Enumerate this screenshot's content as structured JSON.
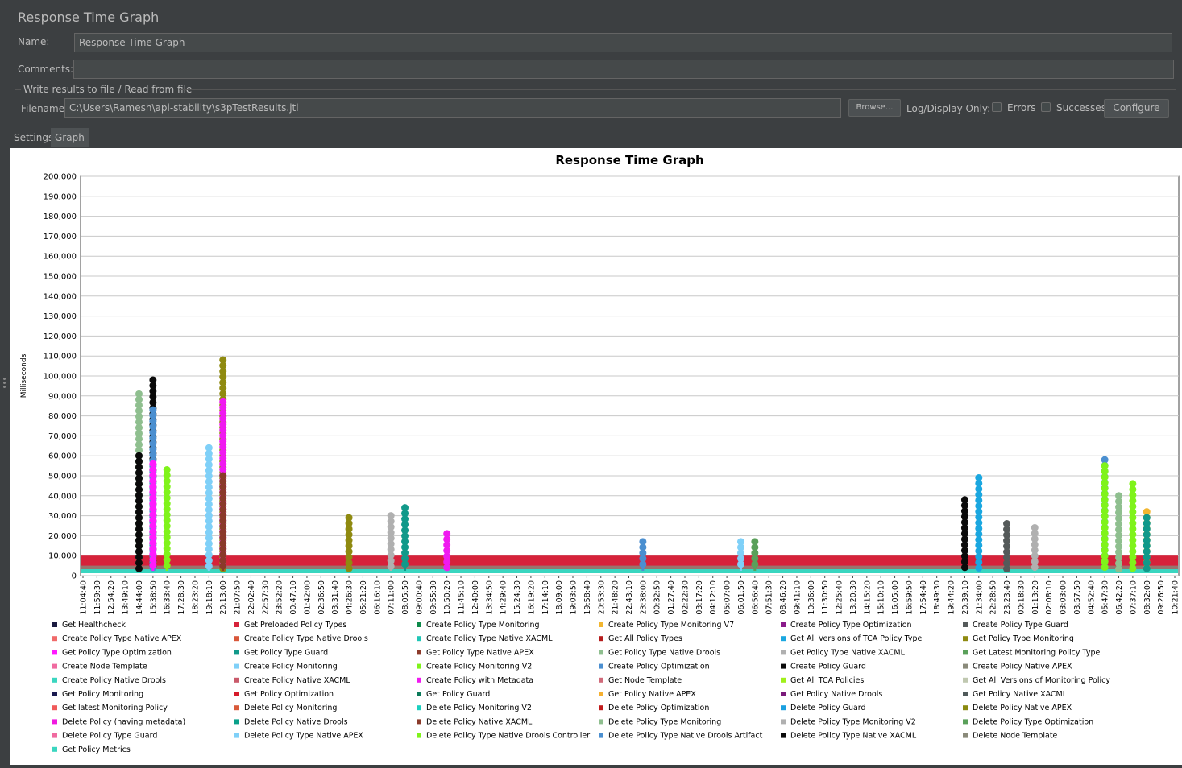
{
  "window": {
    "title": "Response Time Graph"
  },
  "form": {
    "name_label": "Name:",
    "name_value": "Response Time Graph",
    "comments_label": "Comments:",
    "comments_value": "",
    "file_group_label": "Write results to file / Read from file",
    "filename_label": "Filename",
    "filename_value": "C:\\Users\\Ramesh\\api-stability\\s3pTestResults.jtl",
    "browse_label": "Browse...",
    "log_display_label": "Log/Display Only:",
    "errors_label": "Errors",
    "successes_label": "Successes",
    "configure_label": "Configure"
  },
  "tabs": [
    {
      "label": "Settings",
      "active": false
    },
    {
      "label": "Graph",
      "active": true
    }
  ],
  "chart_data": {
    "type": "line",
    "title": "Response Time Graph",
    "ylabel": "Milliseconds",
    "xlabel": "",
    "ylim": [
      0,
      200000
    ],
    "y_ticks": [
      "0",
      "10,000",
      "20,000",
      "30,000",
      "40,000",
      "50,000",
      "60,000",
      "70,000",
      "80,000",
      "90,000",
      "100,000",
      "110,000",
      "120,000",
      "130,000",
      "140,000",
      "150,000",
      "160,000",
      "170,000",
      "180,000",
      "190,000",
      "200,000"
    ],
    "x_ticks": [
      "11:04:40",
      "11:59:30",
      "12:54:20",
      "13:49:10",
      "14:44:00",
      "15:38:50",
      "16:33:40",
      "17:28:30",
      "18:23:20",
      "19:18:10",
      "20:13:00",
      "21:07:50",
      "22:02:40",
      "22:57:30",
      "23:52:20",
      "00:47:10",
      "01:42:00",
      "02:36:50",
      "03:31:40",
      "04:26:30",
      "05:21:20",
      "06:16:10",
      "07:11:00",
      "08:05:50",
      "09:00:40",
      "09:55:30",
      "10:50:20",
      "11:45:10",
      "12:40:00",
      "13:34:50",
      "14:29:40",
      "15:24:30",
      "16:19:20",
      "17:14:10",
      "18:09:00",
      "19:03:50",
      "19:58:40",
      "20:53:30",
      "21:48:20",
      "22:43:10",
      "23:38:00",
      "00:32:50",
      "01:27:40",
      "02:22:30",
      "03:17:20",
      "04:12:10",
      "05:07:00",
      "06:01:50",
      "06:56:40",
      "07:51:30",
      "08:46:20",
      "09:41:10",
      "10:36:00",
      "11:30:50",
      "12:25:40",
      "13:20:30",
      "14:15:20",
      "15:10:10",
      "16:05:00",
      "16:59:50",
      "17:54:40",
      "18:49:30",
      "19:44:20",
      "20:39:10",
      "21:34:00",
      "22:28:50",
      "23:23:40",
      "00:18:30",
      "01:13:20",
      "02:08:10",
      "03:03:00",
      "03:57:50",
      "04:52:40",
      "05:47:30",
      "06:42:20",
      "07:37:10",
      "08:32:00",
      "09:26:50",
      "10:21:40"
    ],
    "grid": true,
    "legend_placement": "bottom",
    "baseline_ms": 10000,
    "series": [
      {
        "name": "Get Healthcheck",
        "color": "#1a1a40"
      },
      {
        "name": "Get Preloaded Policy Types",
        "color": "#d6223a"
      },
      {
        "name": "Create Policy Type Monitoring",
        "color": "#0d8a4a"
      },
      {
        "name": "Create Policy Type Monitoring V7",
        "color": "#f2b630"
      },
      {
        "name": "Create Policy Type Optimization",
        "color": "#8a1a8a"
      },
      {
        "name": "Create Policy Type Guard",
        "color": "#555a5a"
      },
      {
        "name": "Create Policy Type Native APEX",
        "color": "#f06a6a"
      },
      {
        "name": "Create Policy Type Native Drools",
        "color": "#d9573a"
      },
      {
        "name": "Create Policy Type Native XACML",
        "color": "#20c6b6"
      },
      {
        "name": "Get All Policy Types",
        "color": "#b51c1c"
      },
      {
        "name": "Get All Versions of TCA Policy Type",
        "color": "#1aa7e0"
      },
      {
        "name": "Get Policy Type Monitoring",
        "color": "#8f8a10"
      },
      {
        "name": "Get Policy Type Optimization",
        "color": "#ff1aff"
      },
      {
        "name": "Get Policy Type Guard",
        "color": "#11998a"
      },
      {
        "name": "Get Policy Type Native APEX",
        "color": "#8c3a2a"
      },
      {
        "name": "Get Policy Type Native Drools",
        "color": "#8fbf8f"
      },
      {
        "name": "Get Policy Type Native XACML",
        "color": "#b0b0b0"
      },
      {
        "name": "Get Latest Monitoring Policy Type",
        "color": "#5aa05a"
      },
      {
        "name": "Create Node Template",
        "color": "#f06aa0"
      },
      {
        "name": "Create Policy Monitoring",
        "color": "#7fd0f8"
      },
      {
        "name": "Create Policy Monitoring V2",
        "color": "#7ff31a"
      },
      {
        "name": "Create Policy Optimization",
        "color": "#4b8fd0"
      },
      {
        "name": "Create Policy Guard",
        "color": "#0a0a0a"
      },
      {
        "name": "Create Policy Native APEX",
        "color": "#8a8a7a"
      },
      {
        "name": "Create Policy Native Drools",
        "color": "#3ad6c0"
      },
      {
        "name": "Create Policy Native XACML",
        "color": "#c95a6a"
      },
      {
        "name": "Create Policy with Metadata",
        "color": "#f01af0"
      },
      {
        "name": "Get Node Template",
        "color": "#d06a7a"
      },
      {
        "name": "Get All TCA Policies",
        "color": "#a0f01a"
      },
      {
        "name": "Get All Versions of Monitoring Policy",
        "color": "#c0c8b0"
      },
      {
        "name": "Get Policy Monitoring",
        "color": "#1a1a50"
      },
      {
        "name": "Get Policy Optimization",
        "color": "#d61a2a"
      },
      {
        "name": "Get Policy Guard",
        "color": "#0a7a5a"
      },
      {
        "name": "Get Policy Native APEX",
        "color": "#f6b030"
      },
      {
        "name": "Get Policy Native Drools",
        "color": "#7a1a7a"
      },
      {
        "name": "Get Policy Native XACML",
        "color": "#505a5a"
      },
      {
        "name": "Get latest Monitoring Policy",
        "color": "#f05a5a"
      },
      {
        "name": "Delete Policy Monitoring",
        "color": "#d95a3a"
      },
      {
        "name": "Delete Policy Monitoring V2",
        "color": "#1ad0c0"
      },
      {
        "name": "Delete Policy Optimization",
        "color": "#c01a1a"
      },
      {
        "name": "Delete Policy Guard",
        "color": "#1aa0e0"
      },
      {
        "name": "Delete Policy Native APEX",
        "color": "#8a8a10"
      },
      {
        "name": "Delete Policy (having metadata)",
        "color": "#f01ae0"
      },
      {
        "name": "Delete Policy Native Drools",
        "color": "#0aa08a"
      },
      {
        "name": "Delete Policy Native XACML",
        "color": "#8a3a2a"
      },
      {
        "name": "Delete Policy Type Monitoring",
        "color": "#8fbf8f"
      },
      {
        "name": "Delete Policy Type Monitoring V2",
        "color": "#b0b0b0"
      },
      {
        "name": "Delete Policy Type Optimization",
        "color": "#5aa05a"
      },
      {
        "name": "Delete Policy Type Guard",
        "color": "#f06aa0"
      },
      {
        "name": "Delete Policy Type Native APEX",
        "color": "#7fd0f8"
      },
      {
        "name": "Delete Policy Type Native Drools Controller",
        "color": "#7ff31a"
      },
      {
        "name": "Delete Policy Type Native Drools Artifact",
        "color": "#4b8fd0"
      },
      {
        "name": "Delete Policy Type Native XACML",
        "color": "#0a0a0a"
      },
      {
        "name": "Delete Node Template",
        "color": "#8a8a7a"
      },
      {
        "name": "Get Policy Metrics",
        "color": "#3ad6c0"
      }
    ],
    "spikes": [
      {
        "x_tick": "14:44:00",
        "series": "Get Policy Type Native Drools",
        "peak_ms": 91000
      },
      {
        "x_tick": "14:44:00",
        "series": "Create Policy Guard",
        "peak_ms": 60000
      },
      {
        "x_tick": "15:38:50",
        "series": "Create Policy Guard",
        "peak_ms": 98000
      },
      {
        "x_tick": "15:38:50",
        "series": "Create Policy Optimization",
        "peak_ms": 83000
      },
      {
        "x_tick": "15:38:50",
        "series": "Get Policy Type Optimization",
        "peak_ms": 56000
      },
      {
        "x_tick": "16:33:40",
        "series": "Create Policy Monitoring V2",
        "peak_ms": 53000
      },
      {
        "x_tick": "19:18:10",
        "series": "Create Policy Monitoring",
        "peak_ms": 64000
      },
      {
        "x_tick": "20:13:00",
        "series": "Get Policy Type Monitoring",
        "peak_ms": 108000
      },
      {
        "x_tick": "20:13:00",
        "series": "Create Policy with Metadata",
        "peak_ms": 87000
      },
      {
        "x_tick": "20:13:00",
        "series": "Delete Policy Native XACML",
        "peak_ms": 50000
      },
      {
        "x_tick": "04:26:30",
        "series": "Get Policy Type Monitoring",
        "peak_ms": 29000
      },
      {
        "x_tick": "07:11:00",
        "series": "Delete Policy Type Monitoring V2",
        "peak_ms": 30000
      },
      {
        "x_tick": "08:05:50",
        "series": "Get Policy Type Guard",
        "peak_ms": 34000
      },
      {
        "x_tick": "10:50:20",
        "series": "Create Policy with Metadata",
        "peak_ms": 21000
      },
      {
        "x_tick": "23:38:00",
        "series": "Create Policy Optimization",
        "peak_ms": 17000
      },
      {
        "x_tick": "06:01:50",
        "series": "Create Policy Monitoring",
        "peak_ms": 17000
      },
      {
        "x_tick": "06:56:40",
        "series": "Delete Policy Type Optimization",
        "peak_ms": 17000
      },
      {
        "x_tick": "20:39:10",
        "series": "Create Policy Guard",
        "peak_ms": 38000
      },
      {
        "x_tick": "21:34:00",
        "series": "Get All Versions of TCA Policy Type",
        "peak_ms": 49000
      },
      {
        "x_tick": "23:23:40",
        "series": "Create Policy Type Guard",
        "peak_ms": 26000
      },
      {
        "x_tick": "01:13:20",
        "series": "Delete Policy Type Monitoring V2",
        "peak_ms": 24000
      },
      {
        "x_tick": "05:47:30",
        "series": "Create Policy Optimization",
        "peak_ms": 58000
      },
      {
        "x_tick": "05:47:30",
        "series": "Create Policy Monitoring V2",
        "peak_ms": 55000
      },
      {
        "x_tick": "06:42:20",
        "series": "Get Policy Type Native Drools",
        "peak_ms": 40000
      },
      {
        "x_tick": "07:37:10",
        "series": "Create Policy Monitoring V2",
        "peak_ms": 46000
      },
      {
        "x_tick": "08:32:00",
        "series": "Create Policy Type Monitoring V7",
        "peak_ms": 32000
      },
      {
        "x_tick": "08:32:00",
        "series": "Get Policy Type Guard",
        "peak_ms": 29000
      }
    ]
  }
}
